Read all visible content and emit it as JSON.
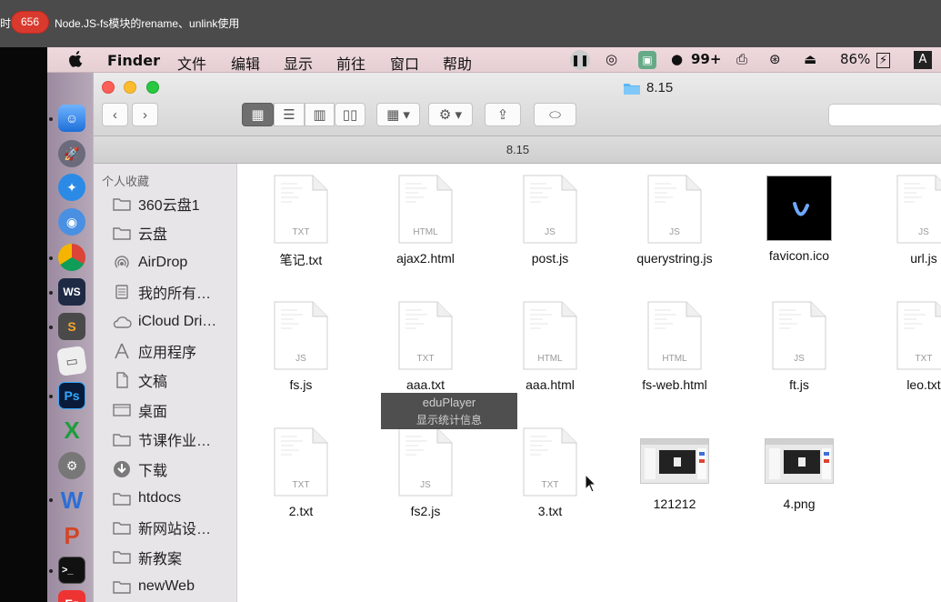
{
  "video_bar": {
    "prev_text": "时",
    "count_badge": "656",
    "title": "Node.JS-fs模块的rename、unlink使用"
  },
  "menubar": {
    "app_name": "Finder",
    "items": [
      "文件",
      "编辑",
      "显示",
      "前往",
      "窗口",
      "帮助"
    ],
    "notifications": "99+",
    "battery": "86%",
    "input_method": "A"
  },
  "window": {
    "title": "8.15",
    "path_title": "8.15"
  },
  "sidebar": {
    "heading": "个人收藏",
    "items": [
      {
        "label": "360云盘1",
        "icon": "folder-icon"
      },
      {
        "label": "云盘",
        "icon": "folder-icon"
      },
      {
        "label": "AirDrop",
        "icon": "airdrop-icon"
      },
      {
        "label": "我的所有…",
        "icon": "all-files-icon"
      },
      {
        "label": "iCloud Dri…",
        "icon": "cloud-icon"
      },
      {
        "label": "应用程序",
        "icon": "applications-icon"
      },
      {
        "label": "文稿",
        "icon": "documents-icon"
      },
      {
        "label": "桌面",
        "icon": "desktop-icon"
      },
      {
        "label": "节课作业…",
        "icon": "folder-icon"
      },
      {
        "label": "下载",
        "icon": "download-icon"
      },
      {
        "label": "htdocs",
        "icon": "folder-icon"
      },
      {
        "label": "新网站设…",
        "icon": "folder-icon"
      },
      {
        "label": "新教案",
        "icon": "folder-icon"
      },
      {
        "label": "newWeb",
        "icon": "folder-icon"
      }
    ]
  },
  "files": [
    {
      "name": "笔记.txt",
      "ext": "TXT",
      "kind": "doc"
    },
    {
      "name": "ajax2.html",
      "ext": "HTML",
      "kind": "doc"
    },
    {
      "name": "post.js",
      "ext": "JS",
      "kind": "doc"
    },
    {
      "name": "querystring.js",
      "ext": "JS",
      "kind": "doc"
    },
    {
      "name": "favicon.ico",
      "ext": "",
      "kind": "ico"
    },
    {
      "name": "url.js",
      "ext": "JS",
      "kind": "doc"
    },
    {
      "name": "fs.js",
      "ext": "JS",
      "kind": "doc"
    },
    {
      "name": "aaa.txt",
      "ext": "TXT",
      "kind": "doc"
    },
    {
      "name": "aaa.html",
      "ext": "HTML",
      "kind": "doc"
    },
    {
      "name": "fs-web.html",
      "ext": "HTML",
      "kind": "doc"
    },
    {
      "name": "ft.js",
      "ext": "JS",
      "kind": "doc"
    },
    {
      "name": "leo.txt",
      "ext": "TXT",
      "kind": "doc"
    },
    {
      "name": "2.txt",
      "ext": "TXT",
      "kind": "doc"
    },
    {
      "name": "fs2.js",
      "ext": "JS",
      "kind": "doc"
    },
    {
      "name": "3.txt",
      "ext": "TXT",
      "kind": "doc"
    },
    {
      "name": "121212",
      "ext": "",
      "kind": "png"
    },
    {
      "name": "4.png",
      "ext": "",
      "kind": "png"
    }
  ],
  "overlay": {
    "brand": "eduPlayer",
    "info": "显示统计信息"
  }
}
